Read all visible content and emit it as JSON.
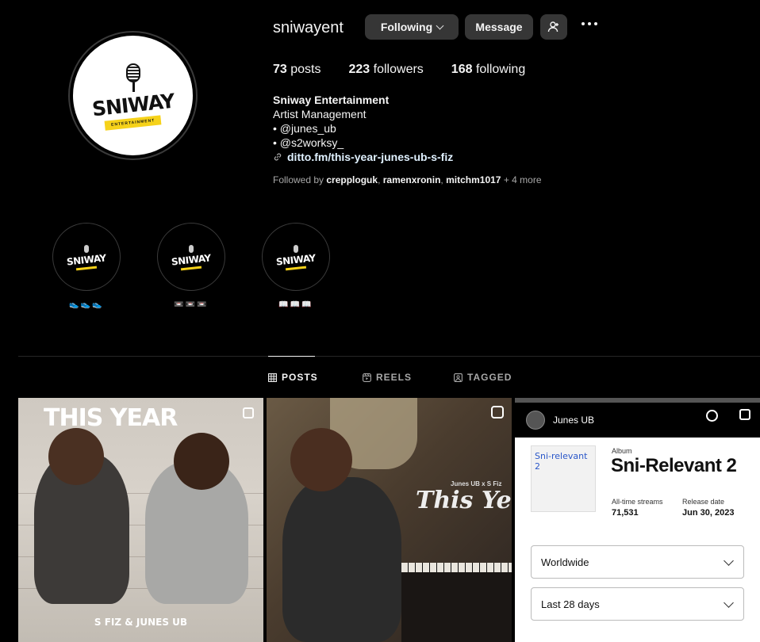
{
  "profile": {
    "username": "sniwayent",
    "following_label": "Following",
    "message_label": "Message",
    "logo_text": "SNIWAY",
    "logo_sub": "ENTERTAINMENT"
  },
  "stats": {
    "posts_count": "73",
    "posts_label": "posts",
    "followers_count": "223",
    "followers_label": "followers",
    "following_count": "168",
    "following_label": "following"
  },
  "bio": {
    "name": "Sniway Entertainment",
    "category": "Artist Management",
    "line1": "• @junes_ub",
    "line2": "• @s2worksy_",
    "link": "ditto.fm/this-year-junes-ub-s-fiz"
  },
  "followed_by": {
    "prefix": "Followed by",
    "user1": "crepploguk",
    "user2": "ramenxronin",
    "user3": "mitchm1017",
    "more": "+ 4 more"
  },
  "highlights": [
    {
      "label": "👟👟👟",
      "logo_text": "SNIWAY"
    },
    {
      "label": "📼📼📼",
      "logo_text": "SNIWAY"
    },
    {
      "label": "📖📖📖",
      "logo_text": "SNIWAY"
    }
  ],
  "tabs": {
    "posts": "POSTS",
    "reels": "REELS",
    "tagged": "TAGGED"
  },
  "posts": {
    "p1_title": "THIS YEAR",
    "p1_footer": "S FIZ & JUNES UB",
    "p2_sub": "Junes UB x S Fiz",
    "p2_title": "This Ye",
    "p3": {
      "artist": "Junes UB",
      "art_text": "Sni-relevant 2",
      "album_label": "Album",
      "album_title": "Sni-Relevant 2",
      "streams_label": "All-time streams",
      "streams_value": "71,531",
      "release_label": "Release date",
      "release_value": "Jun 30, 2023",
      "region": "Worldwide",
      "period": "Last 28 days"
    }
  }
}
